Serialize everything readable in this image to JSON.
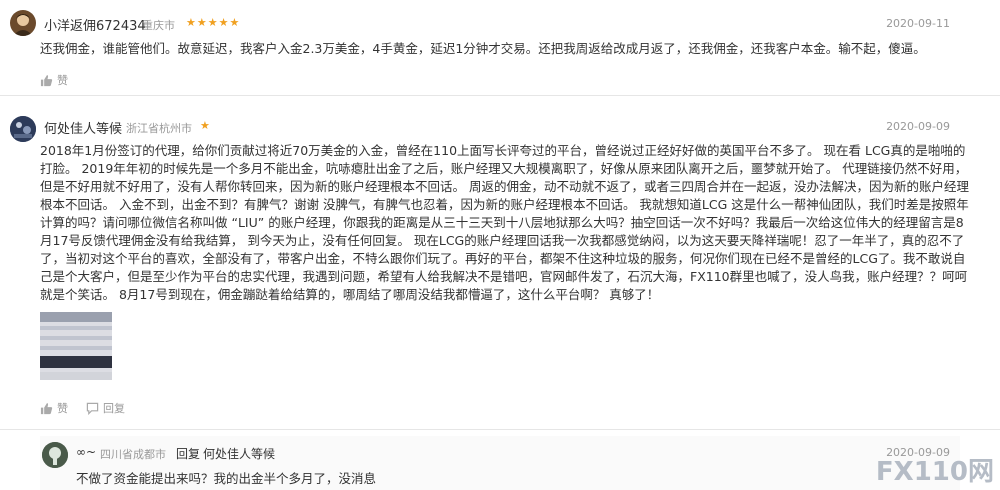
{
  "reviews": [
    {
      "user": "小洋返佣672434",
      "location": "重庆市",
      "stars": "★★★★★",
      "date": "2020-09-11",
      "content": "还我佣金，谁能管他们。故意延迟，我客户入金2.3万美金，4手黄金，延迟1分钟才交易。还把我周返给改成月返了，还我佣金，还我客户本金。输不起，傻逼。",
      "like_label": "赞"
    },
    {
      "user": "何处佳人等候",
      "location": "浙江省杭州市",
      "stars": "★",
      "date": "2020-09-09",
      "content": "2018年1月份签订的代理，给你们贡献过将近70万美金的入金，曾经在110上面写长评夸过的平台，曾经说过正经好好做的英国平台不多了。 现在看 LCG真的是啪啪的打脸。 2019年年初的时候先是一个多月不能出金，吭哧瘪肚出金了之后，账户经理又大规模离职了，好像从原来团队离开之后，噩梦就开始了。 代理链接仍然不好用，但是不好用就不好用了，没有人帮你转回来，因为新的账户经理根本不回话。 周返的佣金，动不动就不返了，或者三四周合并在一起返，没办法解决，因为新的账户经理根本不回话。 入金不到，出金不到？有脾气？谢谢 没脾气，有脾气也忍着，因为新的账户经理根本不回话。 我就想知道LCG 这是什么一帮神仙团队，我们时差是按照年计算的吗？请问哪位微信名称叫做 “LIU” 的账户经理，你跟我的距离是从三十三天到十八层地狱那么大吗？抽空回话一次不好吗？我最后一次给这位伟大的经理留言是8月17号反馈代理佣金没有给我结算， 到今天为止，没有任何回复。 现在LCG的账户经理回话我一次我都感觉纳闷，以为这天要天降祥瑞呢！忍了一年半了，真的忍不了了，当初对这个平台的喜欢，全部没有了，带客户出金，不特么跟你们玩了。再好的平台，都架不住这种垃圾的服务，何况你们现在已经不是曾经的LCG了。我不敢说自己是个大客户，但是至少作为平台的忠实代理，我遇到问题，希望有人给我解决不是错吧，官网邮件发了，石沉大海，FX110群里也喊了，没人鸟我，账户经理？？呵呵 就是个笑话。 8月17号到现在，佣金蹦跶着给结算的，哪周结了哪周没结我都懵逼了，这什么平台啊？ 真够了！",
      "like_label": "赞",
      "reply_label": "回复"
    }
  ],
  "reply": {
    "user": "∞~",
    "location": "四川省成都市",
    "reply_word": "回复",
    "reply_to": "何处佳人等候",
    "date": "2020-09-09",
    "content": "不做了资金能提出来吗？我的出金半个多月了，没消息"
  },
  "watermark": "FX110网",
  "colors": {
    "star": "#f0a020",
    "meta": "#999999",
    "text": "#333333"
  },
  "icons": {
    "like": "thumbs-up-icon",
    "reply": "comment-icon"
  }
}
